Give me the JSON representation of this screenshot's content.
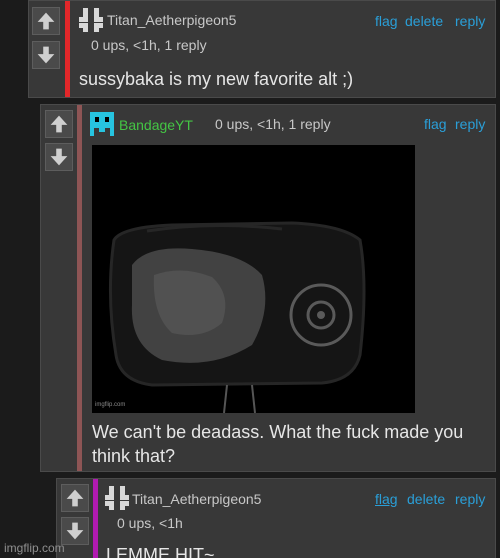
{
  "comments": [
    {
      "username": "Titan_Aetherpigeon5",
      "meta": "0 ups, <1h, 1 reply",
      "actions": [
        "flag",
        "delete",
        "reply"
      ],
      "body": "sussybaka is my new favorite alt ;)",
      "stripe_color": "#e2272a"
    },
    {
      "username": "BandageYT",
      "username_color": "#44c544",
      "meta": "0 ups, <1h, 1 reply",
      "actions": [
        "flag",
        "reply"
      ],
      "image_watermark": "imgflip.com",
      "body_line1": "We can't be deadass. What the fuck made you",
      "body_line2": "think that?",
      "stripe_color": "#8e5555"
    },
    {
      "username": "Titan_Aetherpigeon5",
      "meta": "0 ups, <1h",
      "actions": [
        "flag",
        "delete",
        "reply"
      ],
      "body": "LEMME HIT~",
      "stripe_color": "#b01ab0"
    }
  ],
  "site_watermark": "imgflip.com",
  "colors": {
    "link": "#2a9fd8",
    "background": "#1b1b1b",
    "panel": "#383838"
  }
}
